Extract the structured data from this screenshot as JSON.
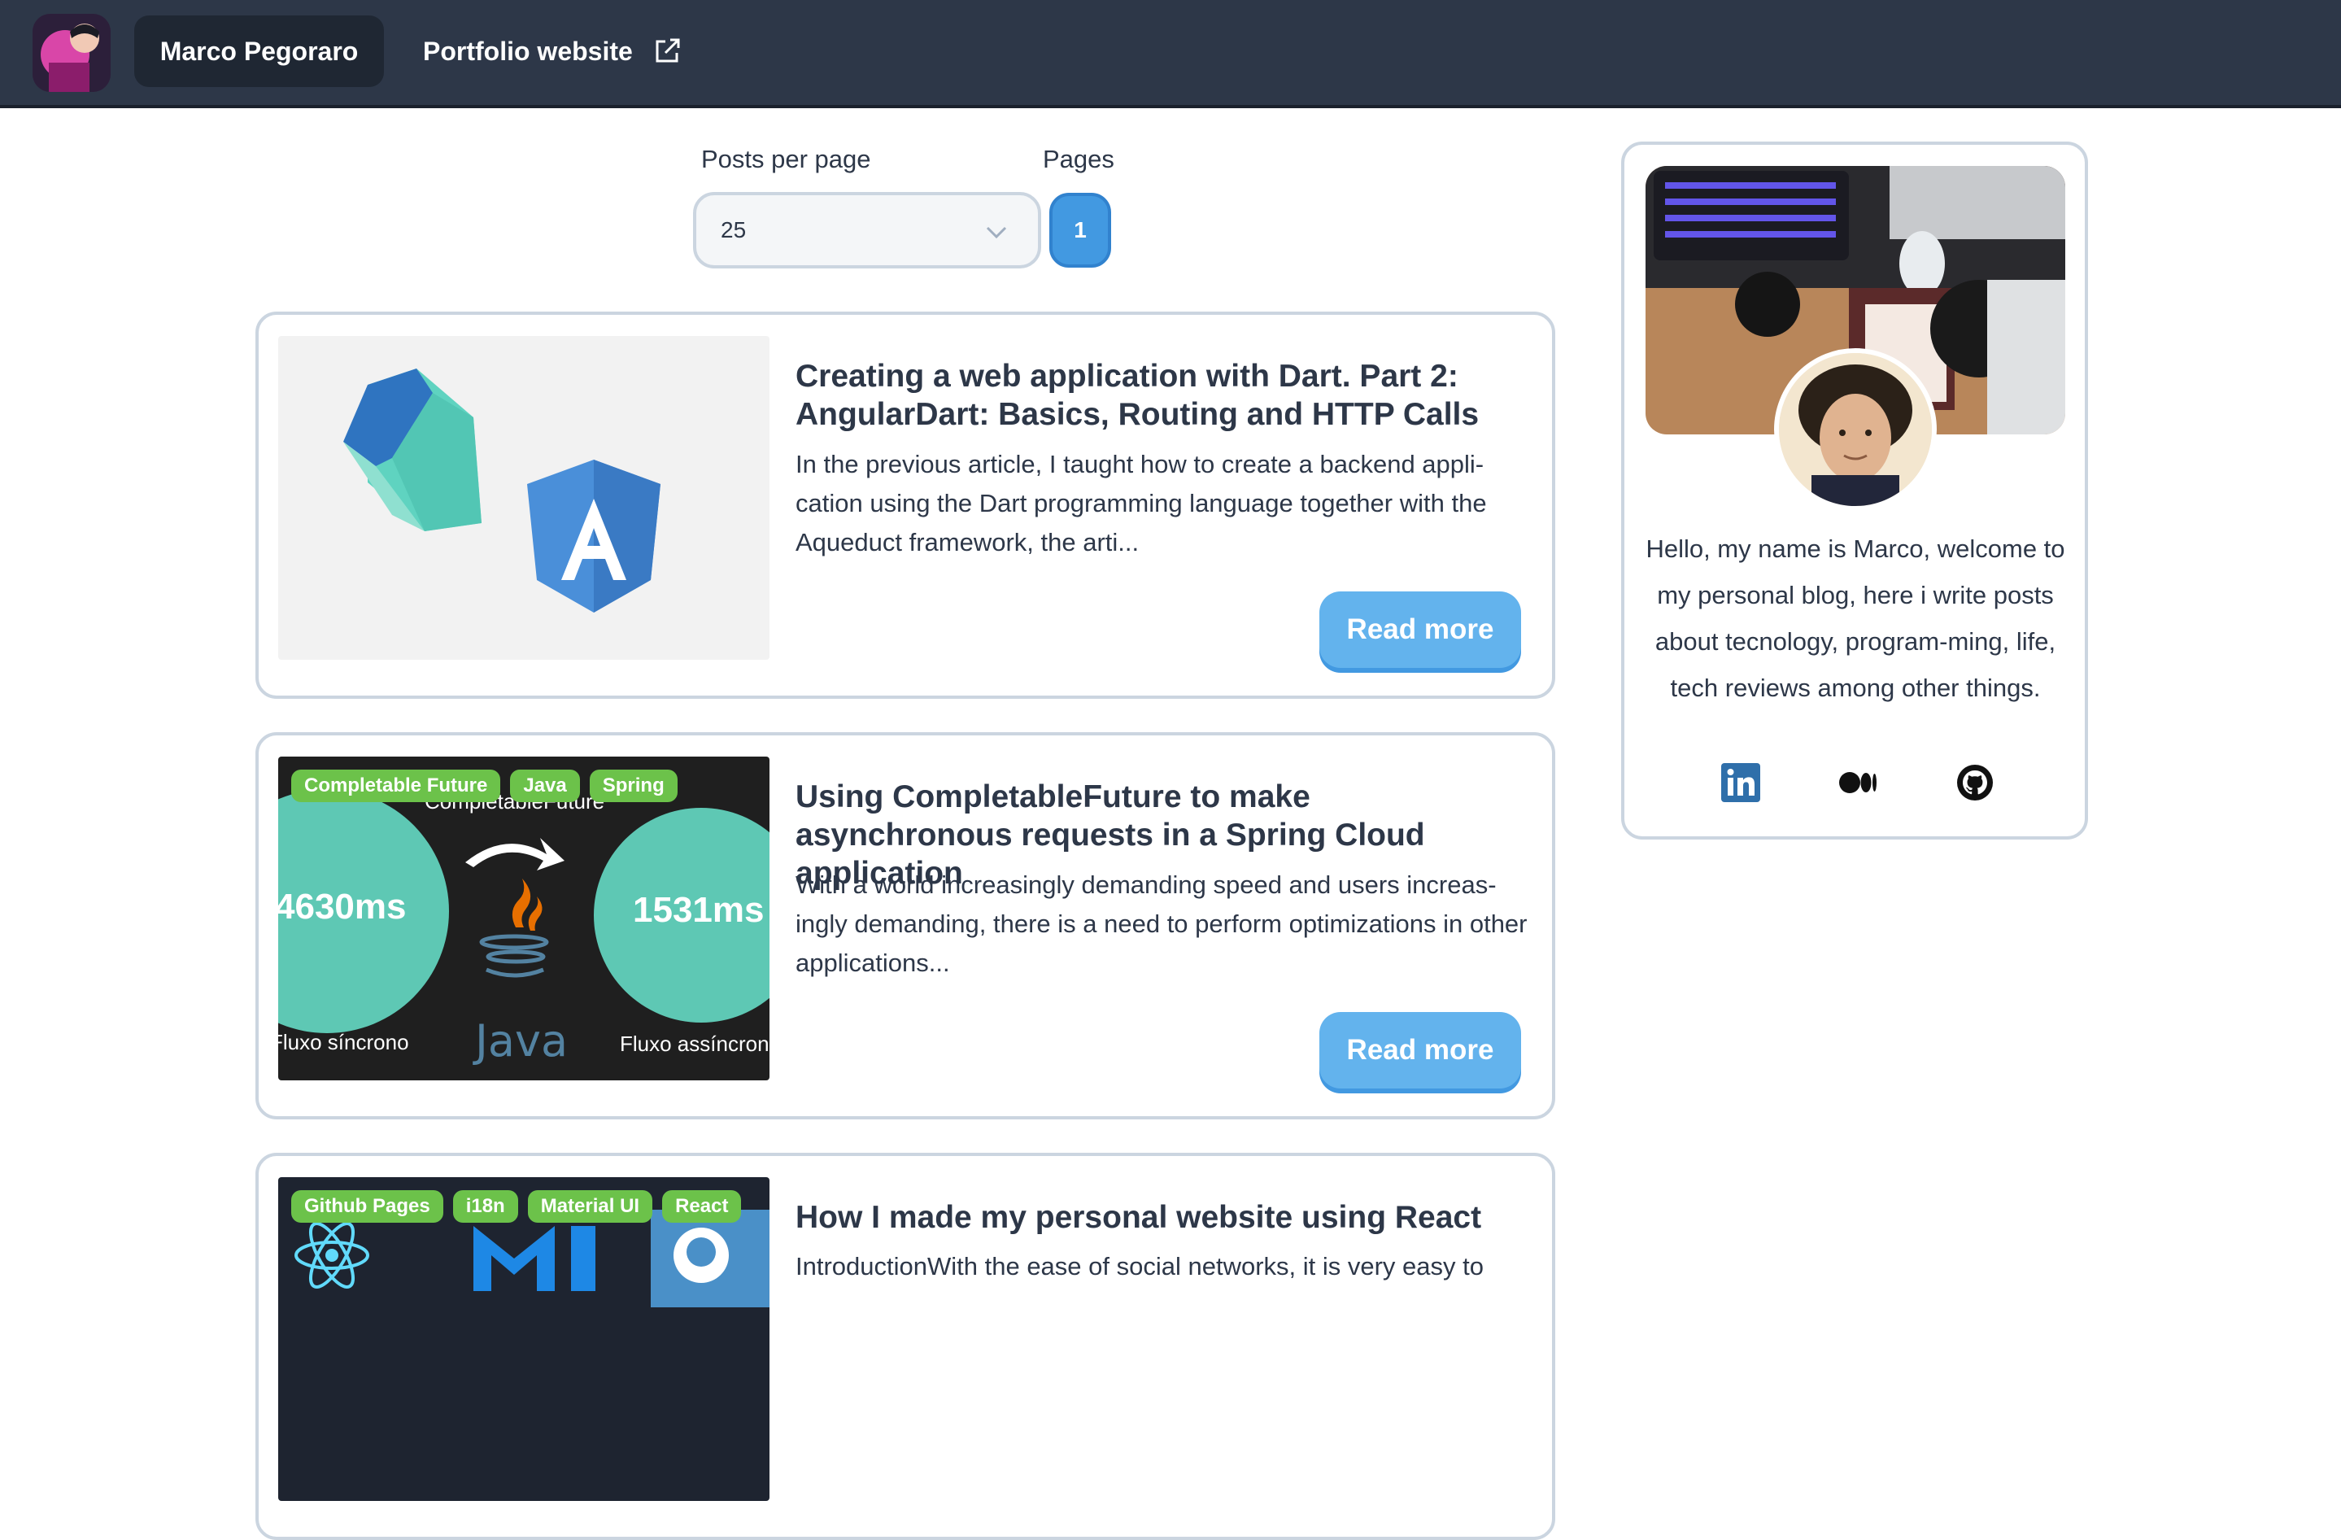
{
  "header": {
    "brand_name": "Marco Pegoraro",
    "portfolio_link": "Portfolio website"
  },
  "controls": {
    "posts_per_page_label": "Posts per page",
    "posts_per_page_value": "25",
    "pages_label": "Pages",
    "current_page": "1"
  },
  "posts": [
    {
      "title": "Creating a web application with Dart. Part 2: AngularDart: Basics, Routing and HTTP Calls",
      "excerpt": "In the previous article, I taught how to create a backend appli-cation using the Dart programming language together with the Aqueduct framework, the arti...",
      "read_more": "Read more",
      "tags": []
    },
    {
      "title": "Using CompletableFuture to make asynchronous requests in a Spring Cloud application",
      "excerpt": "With a world increasingly demanding speed and users increas-ingly demanding, there is a need to perform optimizations in other applications...",
      "read_more": "Read more",
      "tags": [
        "Completable Future",
        "Java",
        "Spring"
      ],
      "image_text": {
        "left_value": "4630ms",
        "right_value": "1531ms",
        "left_caption": "Fluxo síncrono",
        "right_caption": "Fluxo assíncrono",
        "top_caption": "CompletableFuture",
        "java_word": "Java"
      }
    },
    {
      "title": "How I made my personal website using React",
      "excerpt": "IntroductionWith the ease of social networks, it is very easy to",
      "tags": [
        "Github Pages",
        "i18n",
        "Material UI",
        "React"
      ]
    }
  ],
  "profile": {
    "bio": "Hello, my name is Marco, welcome to my personal blog, here i write posts about tecnology, program-ming, life, tech reviews among other things."
  },
  "colors": {
    "header_bg": "#2d3748",
    "accent_blue": "#4299e1",
    "button_blue": "#63b3ed",
    "tag_green": "#6cc24a",
    "border_gray": "#cbd5e0"
  },
  "icons": [
    "external-link-icon",
    "chevron-down-icon",
    "linkedin-icon",
    "medium-icon",
    "github-icon"
  ]
}
